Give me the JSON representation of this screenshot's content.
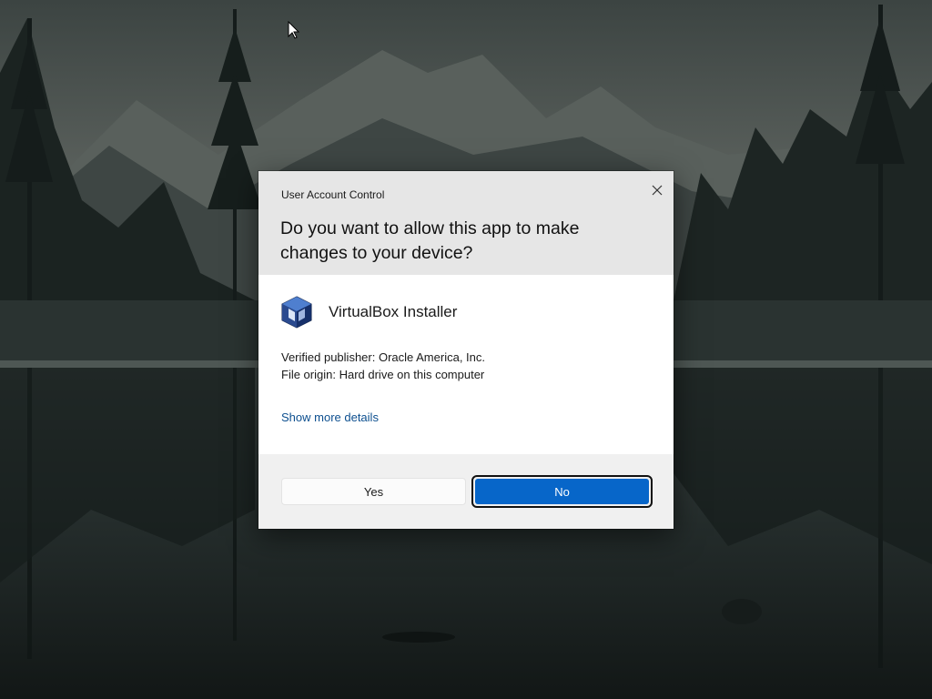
{
  "desktop": {
    "wallpaper": "dark-mountain-lake-forest",
    "cursor_icon": "arrow-cursor-icon"
  },
  "uac": {
    "title": "User Account Control",
    "question": "Do you want to allow this app to make changes to your device?",
    "app_name": "VirtualBox Installer",
    "app_icon": "virtualbox-cube-icon",
    "publisher": "Verified publisher: Oracle America, Inc.",
    "origin": "File origin: Hard drive on this computer",
    "details_link": "Show more details",
    "yes_label": "Yes",
    "no_label": "No",
    "close_icon": "close-icon",
    "colors": {
      "header_bg": "#e6e6e6",
      "footer_bg": "#f0f0f0",
      "link": "#0d4f8f",
      "primary": "#0766c9"
    }
  }
}
